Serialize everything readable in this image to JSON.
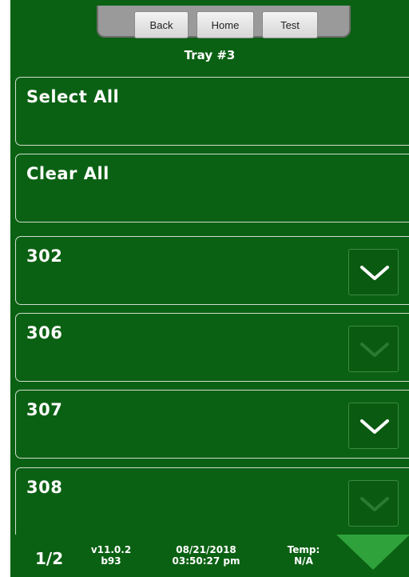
{
  "nav": {
    "back_label": "Back",
    "home_label": "Home",
    "test_label": "Test"
  },
  "tray_title": "Tray #3",
  "actions": {
    "select_all": "Select All",
    "clear_all": "Clear All"
  },
  "items": [
    {
      "label": "302",
      "checked": true
    },
    {
      "label": "306",
      "checked": false
    },
    {
      "label": "307",
      "checked": true
    },
    {
      "label": "308",
      "checked": false
    }
  ],
  "footer": {
    "page": "1/2",
    "version": "v11.0.2",
    "build": "b93",
    "date": "08/21/2018",
    "time": "03:50:27 pm",
    "temp_label": "Temp:",
    "temp_value": "N/A"
  },
  "colors": {
    "background": "#0b6113",
    "check_on": "#ffffff",
    "check_off": "#2a7a32",
    "arrow": "#2fa23b"
  }
}
